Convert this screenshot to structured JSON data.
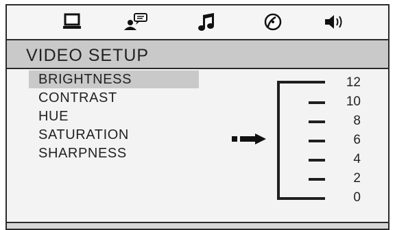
{
  "tabs": [
    {
      "icon": "monitor-icon"
    },
    {
      "icon": "user-speech-icon"
    },
    {
      "icon": "music-note-icon"
    },
    {
      "icon": "disc-icon"
    },
    {
      "icon": "speaker-icon"
    }
  ],
  "section_title": "VIDEO SETUP",
  "menu": {
    "items": [
      {
        "label": "BRIGHTNESS",
        "selected": true
      },
      {
        "label": "CONTRAST",
        "selected": false
      },
      {
        "label": "HUE",
        "selected": false
      },
      {
        "label": "SATURATION",
        "selected": false
      },
      {
        "label": "SHARPNESS",
        "selected": false
      }
    ]
  },
  "level_scale": {
    "labels": [
      "12",
      "10",
      "8",
      "6",
      "4",
      "2",
      "0"
    ],
    "current_value": 6
  },
  "colors": {
    "selection_highlight": "#c9c9c9",
    "frame": "#2a2a2a"
  }
}
